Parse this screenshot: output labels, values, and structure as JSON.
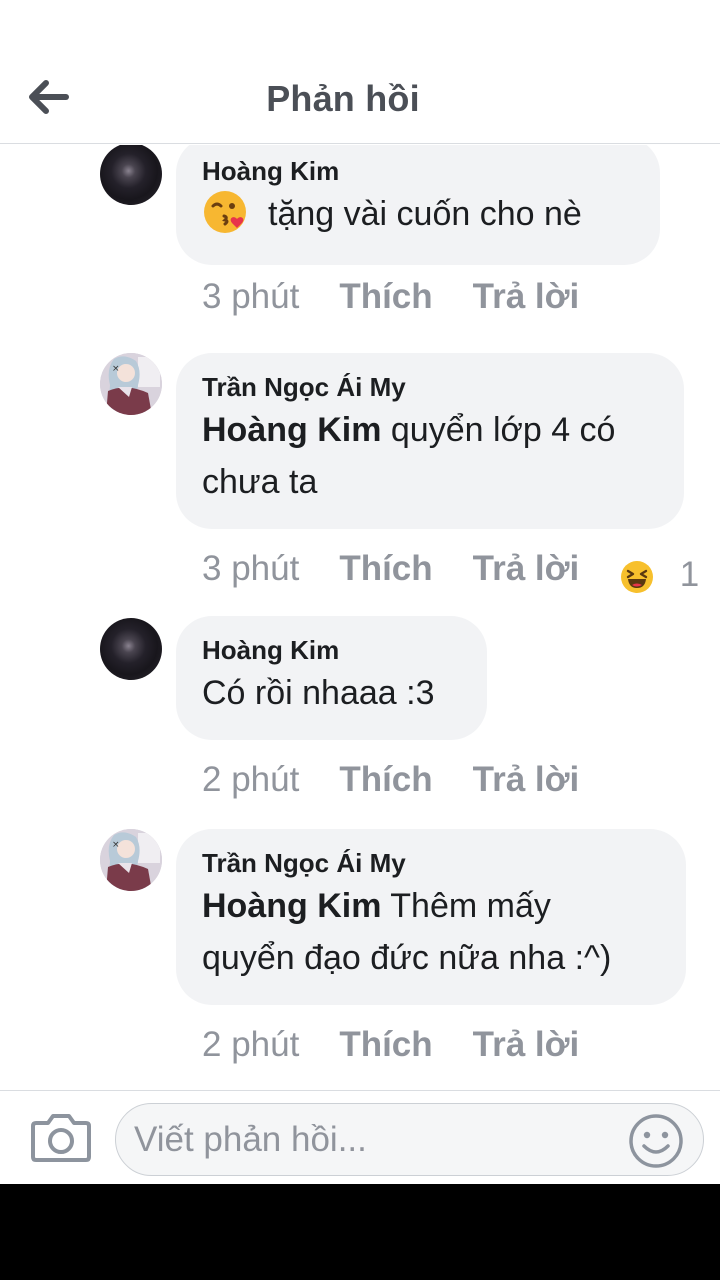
{
  "header": {
    "title": "Phản hồi",
    "back_icon": "arrow-left-icon"
  },
  "comments": [
    {
      "author": "Hoàng Kim",
      "avatar": "dark-avatar",
      "emoji": "face-blowing-kiss-icon",
      "text": "tặng vài cuốn cho nè",
      "time": "3 phút",
      "like_label": "Thích",
      "reply_label": "Trả lời"
    },
    {
      "author": "Trần Ngọc Ái My",
      "avatar": "anime-avatar",
      "mention": "Hoàng Kim",
      "text_line1": " quyển lớp 4 có",
      "text_line2": "chưa ta",
      "time": "3 phút",
      "like_label": "Thích",
      "reply_label": "Trả lời",
      "reaction_icon": "haha-reaction-icon",
      "reaction_count": "1"
    },
    {
      "author": "Hoàng Kim",
      "avatar": "dark-avatar",
      "text": "Có rồi nhaaa :3",
      "time": "2 phút",
      "like_label": "Thích",
      "reply_label": "Trả lời"
    },
    {
      "author": "Trần Ngọc Ái My",
      "avatar": "anime-avatar",
      "mention": "Hoàng Kim",
      "text_line1": " Thêm mấy",
      "text_line2": "quyển đạo đức nữa nha :^)",
      "time": "2 phút",
      "like_label": "Thích",
      "reply_label": "Trả lời"
    }
  ],
  "composer": {
    "placeholder": "Viết phản hồi...",
    "camera_icon": "camera-icon",
    "emoji_icon": "smiley-icon"
  },
  "colors": {
    "bubble": "#f2f3f5",
    "meta_text": "#90949c",
    "header_text": "#4b4f56"
  }
}
